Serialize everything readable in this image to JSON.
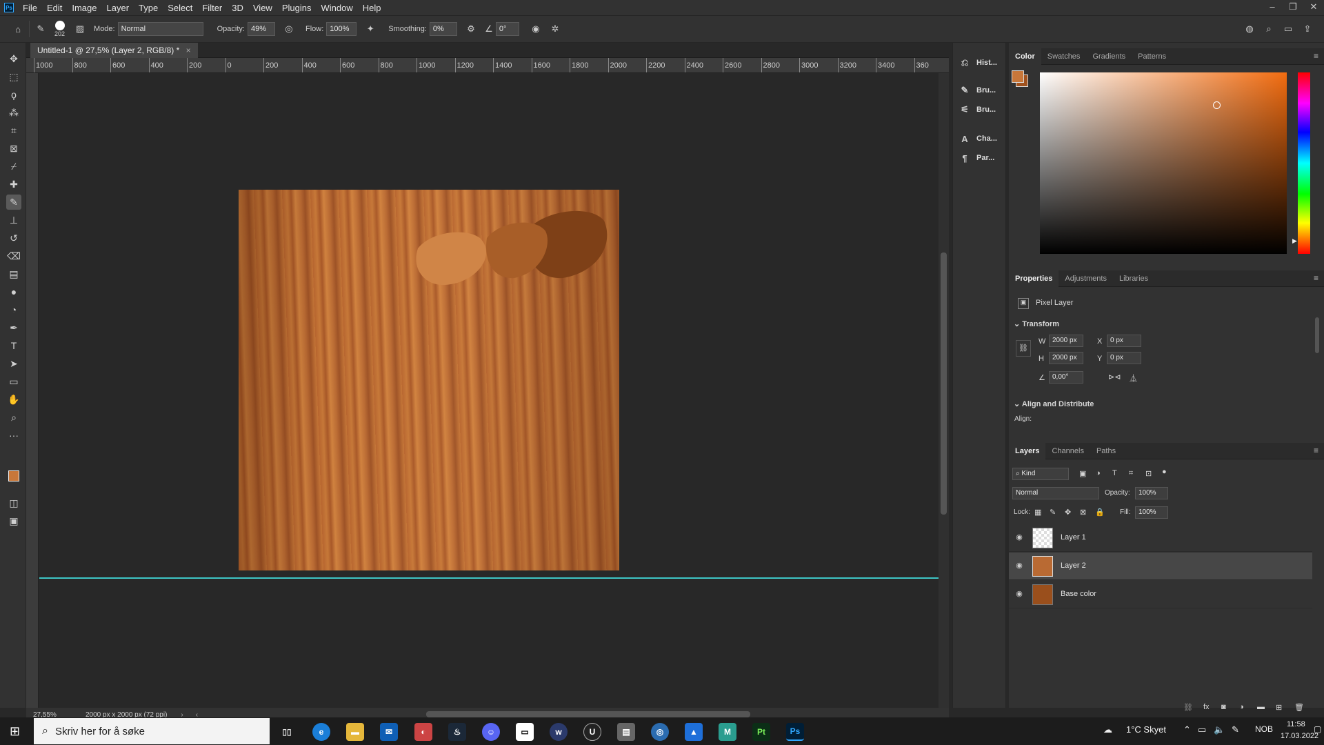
{
  "menu": [
    "File",
    "Edit",
    "Image",
    "Layer",
    "Type",
    "Select",
    "Filter",
    "3D",
    "View",
    "Plugins",
    "Window",
    "Help"
  ],
  "options": {
    "brush_size": "202",
    "mode_label": "Mode:",
    "mode": "Normal",
    "opacity_label": "Opacity:",
    "opacity": "49%",
    "flow_label": "Flow:",
    "flow": "100%",
    "smoothing_label": "Smoothing:",
    "smoothing": "0%",
    "angle": "0°"
  },
  "document": {
    "tab": "Untitled-1 @ 27,5% (Layer 2, RGB/8) *",
    "zoom": "27,55%",
    "info": "2000 px x 2000 px (72 ppi)"
  },
  "ruler_h": [
    "1000",
    "800",
    "600",
    "400",
    "200",
    "0",
    "200",
    "400",
    "600",
    "800",
    "1000",
    "1200",
    "1400",
    "1600",
    "1800",
    "2000",
    "2200",
    "2400",
    "2600",
    "2800",
    "3000",
    "3200",
    "3400",
    "360"
  ],
  "strip": [
    "Hist...",
    "Bru...",
    "Bru...",
    "Cha...",
    "Par..."
  ],
  "color_tabs": [
    "Color",
    "Swatches",
    "Gradients",
    "Patterns"
  ],
  "colors": {
    "foreground": "#c8773a",
    "background": "#a0521e"
  },
  "props_tabs": [
    "Properties",
    "Adjustments",
    "Libraries"
  ],
  "props": {
    "type": "Pixel Layer",
    "transform": "Transform",
    "w_label": "W",
    "w": "2000 px",
    "h_label": "H",
    "h": "2000 px",
    "x_label": "X",
    "x": "0 px",
    "y_label": "Y",
    "y": "0 px",
    "angle": "0,00°",
    "align_title": "Align and Distribute",
    "align_label": "Align:"
  },
  "layers_tabs": [
    "Layers",
    "Channels",
    "Paths"
  ],
  "layers_opts": {
    "kind": "Kind",
    "blend": "Normal",
    "opacity_label": "Opacity:",
    "opacity": "100%",
    "lock_label": "Lock:",
    "fill_label": "Fill:",
    "fill": "100%"
  },
  "layers": [
    {
      "name": "Layer 1"
    },
    {
      "name": "Layer 2"
    },
    {
      "name": "Base color"
    }
  ],
  "taskbar": {
    "search": "Skriv her for å søke",
    "weather": "1°C  Skyet",
    "lang": "NOB",
    "time": "11:58",
    "date": "17.03.2022"
  }
}
